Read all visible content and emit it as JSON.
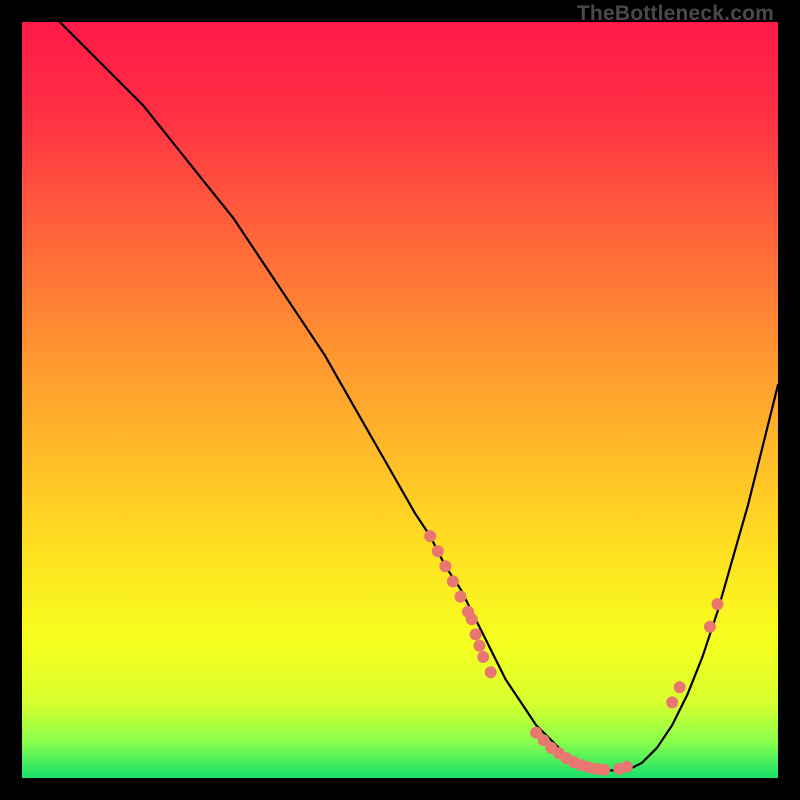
{
  "watermark": "TheBottleneck.com",
  "gradient_stops": [
    {
      "offset": 0.0,
      "color": "#ff1a49"
    },
    {
      "offset": 0.12,
      "color": "#ff2f44"
    },
    {
      "offset": 0.25,
      "color": "#ff5a3c"
    },
    {
      "offset": 0.4,
      "color": "#ff8a33"
    },
    {
      "offset": 0.55,
      "color": "#ffb52a"
    },
    {
      "offset": 0.7,
      "color": "#ffe021"
    },
    {
      "offset": 0.82,
      "color": "#f6ff1f"
    },
    {
      "offset": 0.9,
      "color": "#d8ff2e"
    },
    {
      "offset": 0.95,
      "color": "#8cff4a"
    },
    {
      "offset": 1.0,
      "color": "#18e06a"
    }
  ],
  "curve_color": "#000000",
  "marker_color": "#e87770",
  "chart_data": {
    "type": "line",
    "title": "",
    "xlabel": "",
    "ylabel": "",
    "xlim": [
      0,
      100
    ],
    "ylim": [
      0,
      100
    ],
    "series": [
      {
        "name": "bottleneck-curve",
        "note": "y is visual height (0 at bottom, 100 at top); estimated from pixels",
        "x": [
          0,
          4,
          8,
          12,
          16,
          20,
          24,
          28,
          32,
          36,
          40,
          44,
          48,
          52,
          54,
          56,
          58,
          60,
          62,
          64,
          66,
          68,
          70,
          72,
          74,
          76,
          78,
          80,
          82,
          84,
          86,
          88,
          90,
          92,
          94,
          96,
          98,
          100
        ],
        "y": [
          105,
          101,
          97,
          93,
          89,
          84,
          79,
          74,
          68,
          62,
          56,
          49,
          42,
          35,
          32,
          28,
          25,
          21,
          17,
          13,
          10,
          7,
          5,
          3,
          2,
          1,
          1,
          1,
          2,
          4,
          7,
          11,
          16,
          22,
          29,
          36,
          44,
          52
        ]
      }
    ],
    "markers": {
      "note": "salmon dots along the curve; (x, y) estimated from pixels, same scale as series",
      "points": [
        [
          54,
          32
        ],
        [
          55,
          30
        ],
        [
          56,
          28
        ],
        [
          57,
          26
        ],
        [
          58,
          24
        ],
        [
          59,
          22
        ],
        [
          59.5,
          21
        ],
        [
          60,
          19
        ],
        [
          60.5,
          17.5
        ],
        [
          61,
          16
        ],
        [
          62,
          14
        ],
        [
          68,
          6
        ],
        [
          69,
          5
        ],
        [
          70,
          4
        ],
        [
          71,
          3.3
        ],
        [
          72,
          2.6
        ],
        [
          73,
          2.1
        ],
        [
          74,
          1.7
        ],
        [
          75,
          1.4
        ],
        [
          76,
          1.2
        ],
        [
          77,
          1.1
        ],
        [
          79,
          1.2
        ],
        [
          80,
          1.5
        ],
        [
          86,
          10
        ],
        [
          87,
          12
        ],
        [
          91,
          20
        ],
        [
          92,
          23
        ]
      ]
    }
  }
}
